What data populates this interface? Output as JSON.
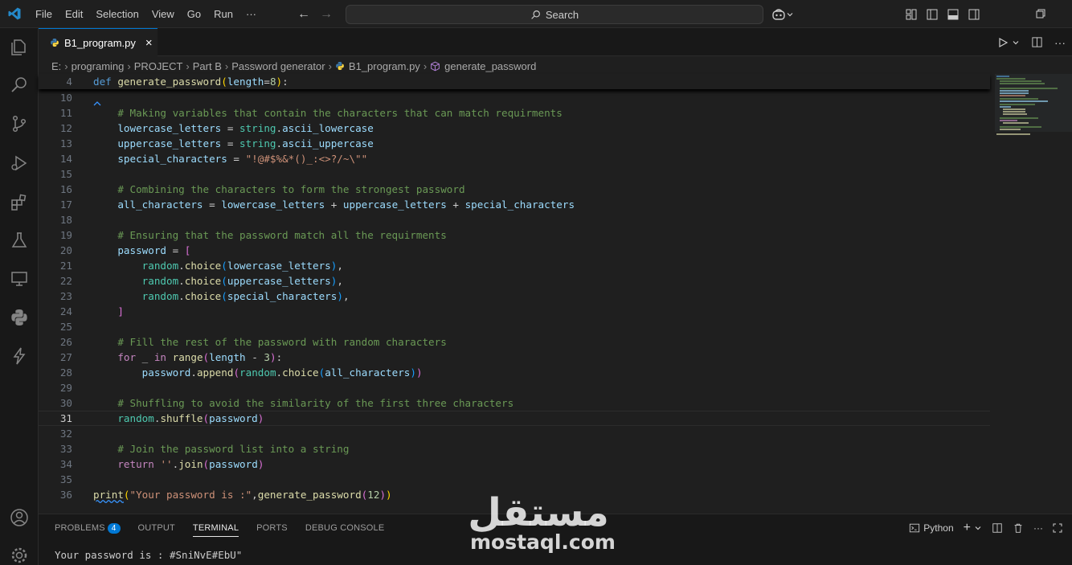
{
  "menu": [
    "File",
    "Edit",
    "Selection",
    "View",
    "Go",
    "Run",
    "···"
  ],
  "search": {
    "label": "Search"
  },
  "tab": {
    "filename": "B1_program.py",
    "close": "×"
  },
  "breadcrumb": [
    "E:",
    "programing",
    "PROJECT",
    "Part B",
    "Password generator",
    "B1_program.py",
    "generate_password"
  ],
  "editor": {
    "active_line": "31",
    "lines": [
      {
        "n": "4",
        "sticky": true,
        "tokens": [
          [
            "k",
            "def"
          ],
          [
            "t",
            " "
          ],
          [
            "fn",
            "generate_password"
          ],
          [
            "b1",
            "("
          ],
          [
            "v",
            "length"
          ],
          [
            "t",
            "="
          ],
          [
            "n",
            "8"
          ],
          [
            "b1",
            ")"
          ],
          [
            "t",
            ":"
          ]
        ]
      },
      {
        "n": "10",
        "tokens": []
      },
      {
        "n": "11",
        "tokens": [
          [
            "t",
            "    "
          ],
          [
            "c",
            "# Making variables that contain the characters that can match requirments"
          ]
        ]
      },
      {
        "n": "12",
        "tokens": [
          [
            "t",
            "    "
          ],
          [
            "v",
            "lowercase_letters"
          ],
          [
            "t",
            " = "
          ],
          [
            "blt",
            "string"
          ],
          [
            "t",
            "."
          ],
          [
            "v",
            "ascii_lowercase"
          ]
        ]
      },
      {
        "n": "13",
        "tokens": [
          [
            "t",
            "    "
          ],
          [
            "v",
            "uppercase_letters"
          ],
          [
            "t",
            " = "
          ],
          [
            "blt",
            "string"
          ],
          [
            "t",
            "."
          ],
          [
            "v",
            "ascii_uppercase"
          ]
        ]
      },
      {
        "n": "14",
        "tokens": [
          [
            "t",
            "    "
          ],
          [
            "v",
            "special_characters"
          ],
          [
            "t",
            " = "
          ],
          [
            "s",
            "\"!@#$%&*()_:<>?/~\\\"\""
          ]
        ]
      },
      {
        "n": "15",
        "tokens": []
      },
      {
        "n": "16",
        "tokens": [
          [
            "t",
            "    "
          ],
          [
            "c",
            "# Combining the characters to form the strongest password"
          ]
        ]
      },
      {
        "n": "17",
        "tokens": [
          [
            "t",
            "    "
          ],
          [
            "v",
            "all_characters"
          ],
          [
            "t",
            " = "
          ],
          [
            "v",
            "lowercase_letters"
          ],
          [
            "t",
            " + "
          ],
          [
            "v",
            "uppercase_letters"
          ],
          [
            "t",
            " + "
          ],
          [
            "v",
            "special_characters"
          ]
        ]
      },
      {
        "n": "18",
        "tokens": []
      },
      {
        "n": "19",
        "tokens": [
          [
            "t",
            "    "
          ],
          [
            "c",
            "# Ensuring that the password match all the requirments"
          ]
        ]
      },
      {
        "n": "20",
        "tokens": [
          [
            "t",
            "    "
          ],
          [
            "v",
            "password"
          ],
          [
            "t",
            " = "
          ],
          [
            "b2",
            "["
          ]
        ]
      },
      {
        "n": "21",
        "tokens": [
          [
            "t",
            "        "
          ],
          [
            "blt",
            "random"
          ],
          [
            "t",
            "."
          ],
          [
            "fn",
            "choice"
          ],
          [
            "b3",
            "("
          ],
          [
            "v",
            "lowercase_letters"
          ],
          [
            "b3",
            ")"
          ],
          [
            "t",
            ","
          ]
        ]
      },
      {
        "n": "22",
        "tokens": [
          [
            "t",
            "        "
          ],
          [
            "blt",
            "random"
          ],
          [
            "t",
            "."
          ],
          [
            "fn",
            "choice"
          ],
          [
            "b3",
            "("
          ],
          [
            "v",
            "uppercase_letters"
          ],
          [
            "b3",
            ")"
          ],
          [
            "t",
            ","
          ]
        ]
      },
      {
        "n": "23",
        "tokens": [
          [
            "t",
            "        "
          ],
          [
            "blt",
            "random"
          ],
          [
            "t",
            "."
          ],
          [
            "fn",
            "choice"
          ],
          [
            "b3",
            "("
          ],
          [
            "v",
            "special_characters"
          ],
          [
            "b3",
            ")"
          ],
          [
            "t",
            ","
          ]
        ]
      },
      {
        "n": "24",
        "tokens": [
          [
            "t",
            "    "
          ],
          [
            "b2",
            "]"
          ]
        ]
      },
      {
        "n": "25",
        "tokens": []
      },
      {
        "n": "26",
        "tokens": [
          [
            "t",
            "    "
          ],
          [
            "c",
            "# Fill the rest of the password with random characters"
          ]
        ]
      },
      {
        "n": "27",
        "tokens": [
          [
            "t",
            "    "
          ],
          [
            "kc",
            "for"
          ],
          [
            "t",
            " _ "
          ],
          [
            "kc",
            "in"
          ],
          [
            "t",
            " "
          ],
          [
            "fn",
            "range"
          ],
          [
            "b2",
            "("
          ],
          [
            "v",
            "length"
          ],
          [
            "t",
            " - "
          ],
          [
            "n",
            "3"
          ],
          [
            "b2",
            ")"
          ],
          [
            "t",
            ":"
          ]
        ]
      },
      {
        "n": "28",
        "tokens": [
          [
            "t",
            "        "
          ],
          [
            "v",
            "password"
          ],
          [
            "t",
            "."
          ],
          [
            "fn",
            "append"
          ],
          [
            "b2",
            "("
          ],
          [
            "blt",
            "random"
          ],
          [
            "t",
            "."
          ],
          [
            "fn",
            "choice"
          ],
          [
            "b3",
            "("
          ],
          [
            "v",
            "all_characters"
          ],
          [
            "b3",
            ")"
          ],
          [
            "b2",
            ")"
          ]
        ]
      },
      {
        "n": "29",
        "tokens": []
      },
      {
        "n": "30",
        "tokens": [
          [
            "t",
            "    "
          ],
          [
            "c",
            "# Shuffling to avoid the similarity of the first three characters"
          ]
        ]
      },
      {
        "n": "31",
        "tokens": [
          [
            "t",
            "    "
          ],
          [
            "blt",
            "random"
          ],
          [
            "t",
            "."
          ],
          [
            "fn",
            "shuffle"
          ],
          [
            "b2",
            "("
          ],
          [
            "v",
            "password"
          ],
          [
            "b2",
            ")"
          ]
        ]
      },
      {
        "n": "32",
        "tokens": []
      },
      {
        "n": "33",
        "tokens": [
          [
            "t",
            "    "
          ],
          [
            "c",
            "# Join the password list into a string"
          ]
        ]
      },
      {
        "n": "34",
        "tokens": [
          [
            "t",
            "    "
          ],
          [
            "kc",
            "return"
          ],
          [
            "t",
            " "
          ],
          [
            "s",
            "''"
          ],
          [
            "t",
            "."
          ],
          [
            "fn",
            "join"
          ],
          [
            "b2",
            "("
          ],
          [
            "v",
            "password"
          ],
          [
            "b2",
            ")"
          ]
        ]
      },
      {
        "n": "35",
        "tokens": []
      },
      {
        "n": "36",
        "tokens": [
          [
            "fn",
            "print"
          ],
          [
            "b1",
            "("
          ],
          [
            "s",
            "\"Your password is :\""
          ],
          [
            "t",
            ","
          ],
          [
            "fn",
            "generate_password"
          ],
          [
            "b2",
            "("
          ],
          [
            "n",
            "12"
          ],
          [
            "b2",
            ")"
          ],
          [
            "b1",
            ")"
          ]
        ]
      }
    ]
  },
  "panel": {
    "tabs": [
      "PROBLEMS",
      "OUTPUT",
      "TERMINAL",
      "PORTS",
      "DEBUG CONSOLE"
    ],
    "problems_count": "4",
    "active_tab": "TERMINAL",
    "shell_label": "Python",
    "terminal_output": "Your password is : #SniNvE#EbU\""
  },
  "watermark": {
    "arabic": "مستقل",
    "latin": "mostaql.com"
  },
  "colors": {
    "accent": "#0078d4",
    "background": "#1f1f1f",
    "sidebar": "#181818"
  }
}
